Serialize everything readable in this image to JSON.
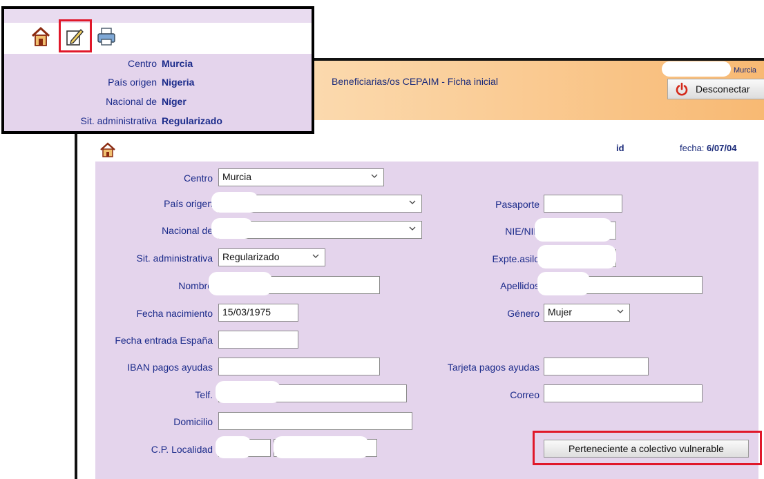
{
  "header": {
    "title": "Beneficiarias/os CEPAIM - Ficha inicial",
    "city": "Murcia",
    "logout_label": "Desconectar"
  },
  "record": {
    "id_label": "id",
    "fecha_label": "fecha:",
    "fecha_value": "6/07/04"
  },
  "form": {
    "centro": {
      "label": "Centro",
      "value": "Murcia"
    },
    "pais_origen": {
      "label": "País origen"
    },
    "nacional_de": {
      "label": "Nacional de"
    },
    "sit_administrativa": {
      "label": "Sit. administrativa",
      "value": "Regularizado"
    },
    "nombre": {
      "label": "Nombre"
    },
    "fecha_nacimiento": {
      "label": "Fecha nacimiento",
      "value": "15/03/1975"
    },
    "fecha_entrada": {
      "label": "Fecha entrada España",
      "value": ""
    },
    "iban": {
      "label": "IBAN pagos ayudas",
      "value": ""
    },
    "telf": {
      "label": "Telf."
    },
    "domicilio": {
      "label": "Domicilio",
      "value": ""
    },
    "cp_localidad": {
      "label": "C.P. Localidad"
    },
    "pasaporte": {
      "label": "Pasaporte",
      "value": ""
    },
    "nie_nif": {
      "label": "NIE/NIF"
    },
    "expte_asilo": {
      "label": "Expte.asilo"
    },
    "apellidos": {
      "label": "Apellidos"
    },
    "genero": {
      "label": "Género",
      "value": "Mujer"
    },
    "tarjeta": {
      "label": "Tarjeta pagos ayudas",
      "value": ""
    },
    "correo": {
      "label": "Correo",
      "value": ""
    },
    "vulnerable_button": "Perteneciente a colectivo vulnerable"
  },
  "zoom": {
    "rows": [
      {
        "label": "Centro",
        "value": "Murcia"
      },
      {
        "label": "País origen",
        "value": "Nigeria"
      },
      {
        "label": "Nacional de",
        "value": "Níger"
      },
      {
        "label": "Sit. administrativa",
        "value": "Regularizado"
      }
    ]
  },
  "colors": {
    "label_blue": "#1a2a8a",
    "panel_purple": "#e4d4ec",
    "highlight_red": "#e0182a",
    "header_orange": "#f8b973"
  },
  "icons": [
    "home-icon",
    "edit-icon",
    "print-icon",
    "power-icon",
    "chevron-down-icon"
  ]
}
